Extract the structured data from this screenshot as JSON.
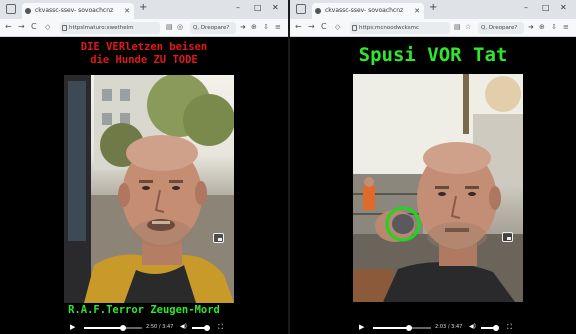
{
  "colors": {
    "caption_red": "#e01818",
    "caption_green": "#2ee82e",
    "circle_green": "#1fd61f"
  },
  "left": {
    "tab_title": "ckvassc-ssev- sovoachcnz",
    "url": "httpslmaturo:xwethelm",
    "search": "Q, Dreopare?",
    "caption_top_line1": "DIE VERletzen beisen",
    "caption_top_line2": "die Hunde ZU TODE",
    "caption_bottom": "R.A.F.Terror Zeugen-Mord",
    "time": "2:50 / 3:47",
    "progress": 0.67
  },
  "right": {
    "tab_title": "ckvassc-ssev- sovoachcnz",
    "url": "https:mcnoodwcksmc",
    "search": "Q, Dreopare?",
    "caption_top": "Spusi VOR Tat",
    "time": "2:03 / 3:47",
    "progress": 0.62
  },
  "icons": {
    "new_tab": "+",
    "minimize": "–",
    "maximize": "□",
    "close": "✕",
    "back": "←",
    "forward": "→",
    "reload": "C",
    "play": "▶",
    "volume": "🔊",
    "fullscreen": "⛶"
  }
}
